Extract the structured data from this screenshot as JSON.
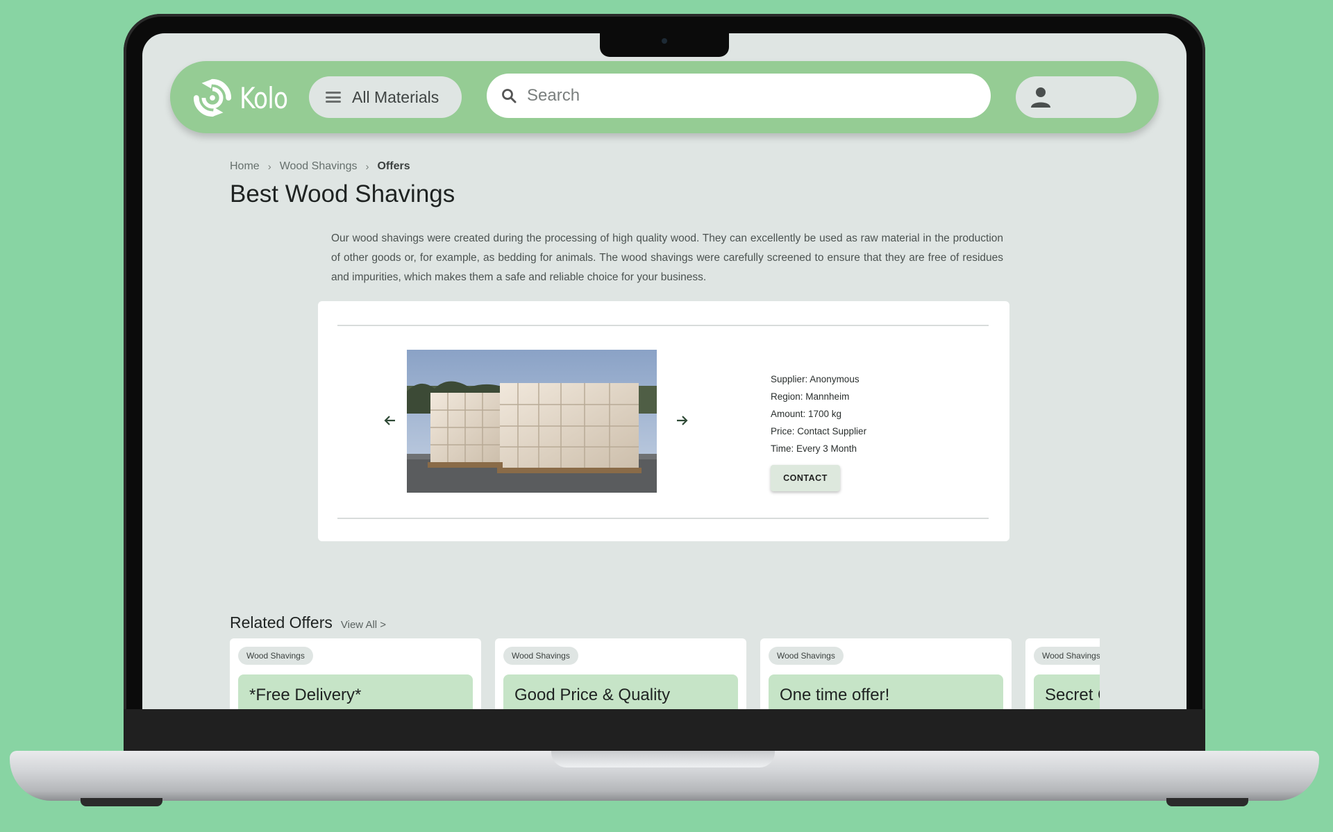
{
  "header": {
    "logo_text": "Kolo",
    "all_materials_label": "All Materials",
    "search_placeholder": "Search"
  },
  "breadcrumb": {
    "items": [
      "Home",
      "Wood Shavings",
      "Offers"
    ]
  },
  "page": {
    "title": "Best Wood Shavings",
    "description": "Our wood shavings were created during the processing of high quality wood. They can excellently be used as raw material in the production of other goods or, for example, as bedding for animals. The wood shavings were carefully screened to ensure that they are free of residues and impurities, which makes them a safe and reliable choice for your business."
  },
  "offer": {
    "supplier": "Supplier: Anonymous",
    "region": "Region: Mannheim",
    "amount": "Amount: 1700 kg",
    "price": "Price: Contact Supplier",
    "time": "Time: Every 3 Month",
    "contact_label": "CONTACT"
  },
  "related": {
    "title": "Related Offers",
    "view_all": "View All >",
    "cards": [
      {
        "tag": "Wood Shavings",
        "title": "*Free Delivery*"
      },
      {
        "tag": "Wood Shavings",
        "title": "Good Price & Quality"
      },
      {
        "tag": "Wood Shavings",
        "title": "One time offer!"
      },
      {
        "tag": "Wood Shavings",
        "title": "Secret Offer"
      }
    ]
  },
  "colors": {
    "background": "#88d4a3",
    "header_green": "#95cc94",
    "screen_bg": "#dfe5e3",
    "card_banner_green": "#c6e4c7"
  }
}
